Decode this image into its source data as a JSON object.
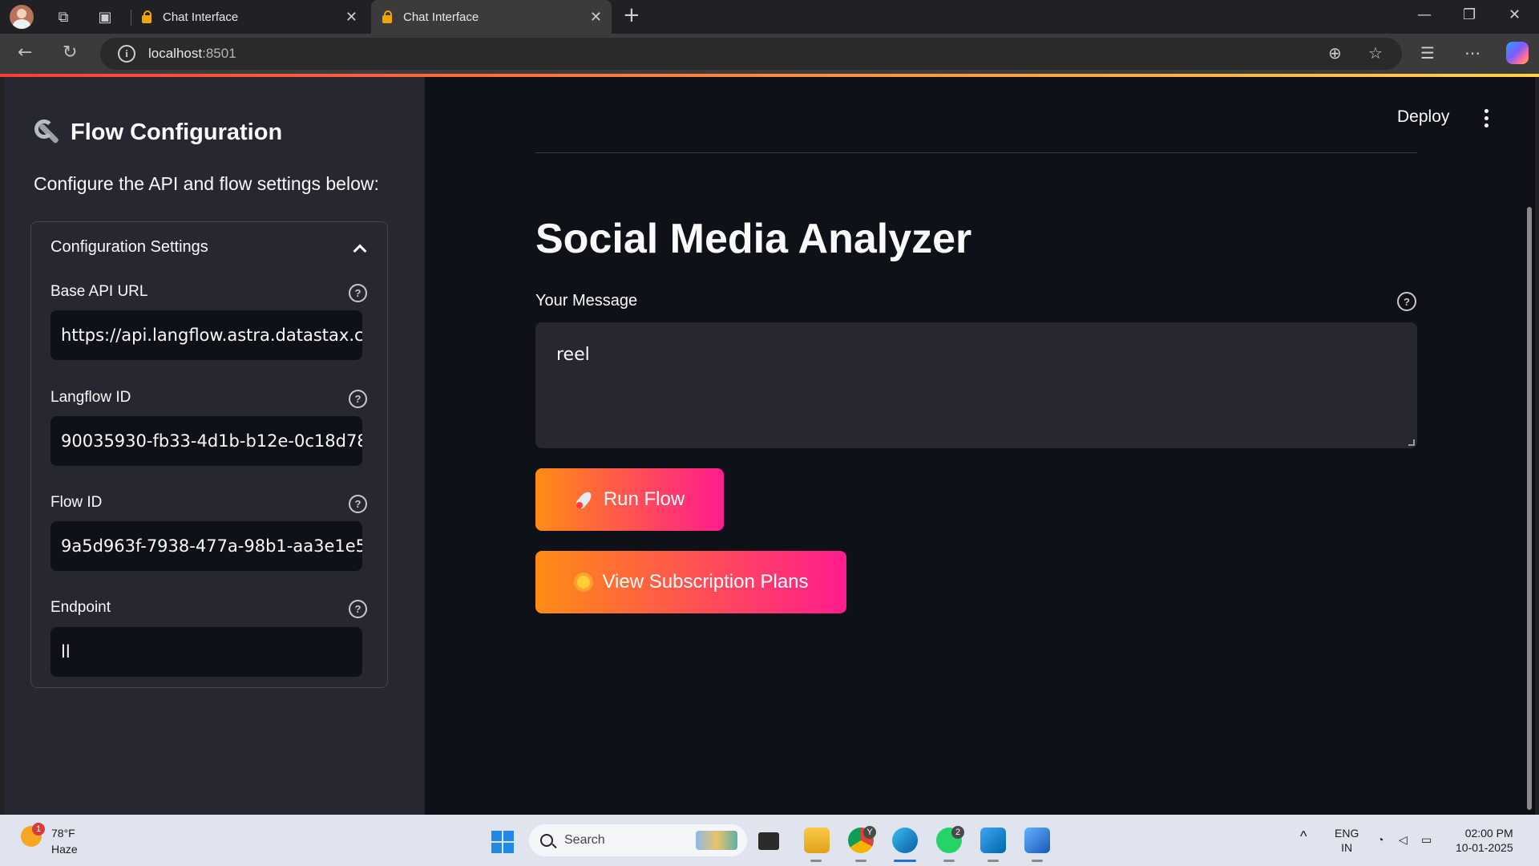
{
  "browser": {
    "tabs": [
      {
        "title": "Chat Interface"
      },
      {
        "title": "Chat Interface"
      }
    ],
    "url_host": "localhost",
    "url_port": ":8501"
  },
  "sidebar": {
    "title": "Flow Configuration",
    "description": "Configure the API and flow settings below:",
    "expander_title": "Configuration Settings",
    "fields": [
      {
        "label": "Base API URL",
        "value": "https://api.langflow.astra.datastax.com"
      },
      {
        "label": "Langflow ID",
        "value": "90035930-fb33-4d1b-b12e-0c18d78"
      },
      {
        "label": "Flow ID",
        "value": "9a5d963f-7938-477a-98b1-aa3e1e5"
      },
      {
        "label": "Endpoint",
        "value": "ll"
      }
    ]
  },
  "header": {
    "deploy_label": "Deploy"
  },
  "main": {
    "title": "Social Media Analyzer",
    "message_label": "Your Message",
    "message_value": "reel",
    "run_button": "Run Flow",
    "plans_button": "View Subscription Plans"
  },
  "taskbar": {
    "weather_badge": "1",
    "weather_temp": "78°F",
    "weather_desc": "Haze",
    "search_label": "Search",
    "chrome_badge": "Y",
    "whatsapp_badge": "2",
    "lang_top": "ENG",
    "lang_bottom": "IN",
    "time": "02:00 PM",
    "date": "10-01-2025"
  },
  "colors": {
    "sidebar_bg": "#262730",
    "main_bg": "#0e1117",
    "button_gradient_start": "#ff8c14",
    "button_gradient_end": "#ff1d8e"
  }
}
